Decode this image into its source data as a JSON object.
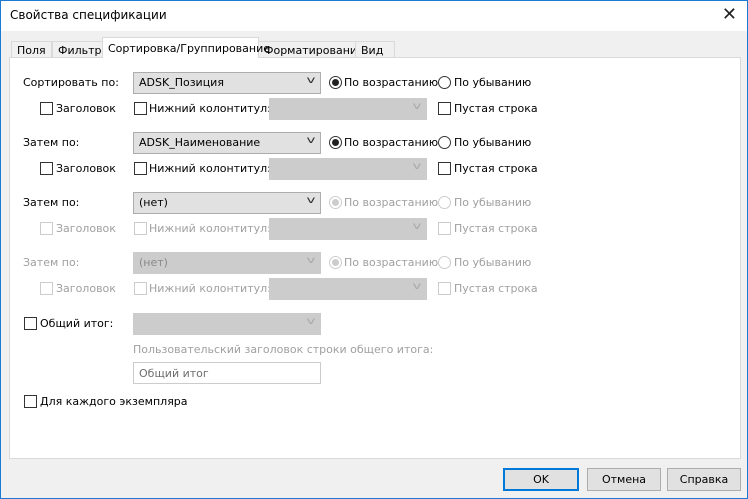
{
  "window": {
    "title": "Свойства спецификации"
  },
  "tabs": [
    {
      "label": "Поля"
    },
    {
      "label": "Фильтр"
    },
    {
      "label": "Сортировка/Группирование"
    },
    {
      "label": "Форматирование"
    },
    {
      "label": "Вид"
    }
  ],
  "active_tab": "Сортировка/Группирование",
  "sort_groups": [
    {
      "label": "Сортировать по:",
      "field": "ADSK_Позиция",
      "order": "ascending",
      "enabled": true,
      "header_checked": false,
      "footer_checked": false,
      "footer_value": "",
      "blank_line_checked": false
    },
    {
      "label": "Затем по:",
      "field": "ADSK_Наименование",
      "order": "ascending",
      "enabled": true,
      "header_checked": false,
      "footer_checked": false,
      "footer_value": "",
      "blank_line_checked": false
    },
    {
      "label": "Затем по:",
      "field": "(нет)",
      "order": "ascending",
      "enabled": true,
      "sub_enabled": false,
      "header_checked": false,
      "footer_checked": false,
      "footer_value": "",
      "blank_line_checked": false
    },
    {
      "label": "Затем по:",
      "field": "(нет)",
      "order": "ascending",
      "enabled": false,
      "sub_enabled": false,
      "header_checked": false,
      "footer_checked": false,
      "footer_value": "",
      "blank_line_checked": false
    }
  ],
  "labels": {
    "ascending": "По возрастанию",
    "descending": "По убыванию",
    "header": "Заголовок",
    "footer": "Нижний колонтитул:",
    "blank_line": "Пустая строка"
  },
  "grand_total": {
    "label": "Общий итог:",
    "checked": false,
    "value": "",
    "custom_title_label": "Пользовательский заголовок строки общего итога:",
    "custom_title_value": "Общий итог"
  },
  "itemize": {
    "label": "Для каждого экземпляра",
    "checked": false
  },
  "buttons": {
    "ok": "OK",
    "cancel": "Отмена",
    "help": "Справка"
  }
}
